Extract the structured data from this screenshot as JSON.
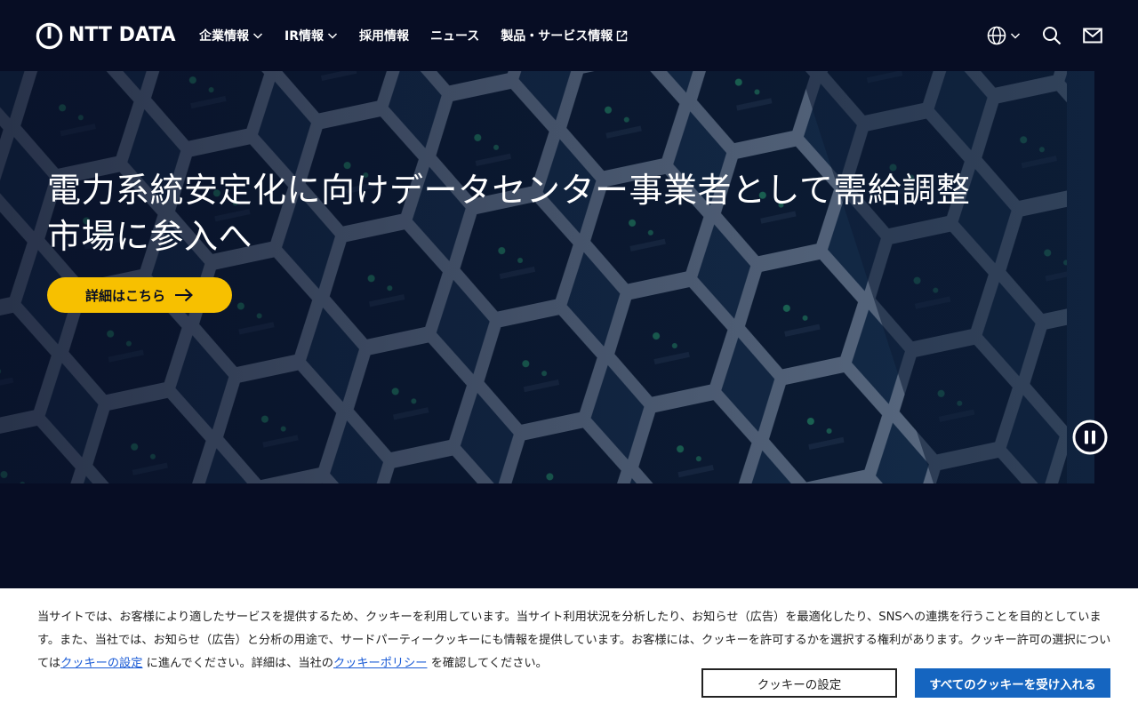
{
  "brand": {
    "logo_text": "NTT DATA",
    "logo_icon": "ntt-data-logo-icon"
  },
  "nav": {
    "items": [
      {
        "label": "企業情報",
        "icon": "chevron-down-icon"
      },
      {
        "label": "IR情報",
        "icon": "chevron-down-icon"
      },
      {
        "label": "採用情報"
      },
      {
        "label": "ニュース"
      },
      {
        "label": "製品・サービス情報",
        "icon": "external-link-icon"
      }
    ]
  },
  "header_actions": {
    "language_icon": "globe-icon",
    "search_icon": "search-icon",
    "contact_icon": "mail-icon"
  },
  "hero": {
    "title": "電力系統安定化に向けデータセンター事業者として需給調整市場に参入へ",
    "cta_label": "詳細はこちら",
    "cta_icon": "arrow-right-icon",
    "pause_icon": "pause-icon",
    "background": "server-rack-photo"
  },
  "cookie": {
    "text_part1": "当サイトでは、お客様により適したサービスを提供するため、クッキーを利用しています。当サイト利用状況を分析したり、お知らせ（広告）を最適化したり、SNSへの連携を行うことを目的としています。また、当社では、お知らせ（広告）と分析の用途で、サードパーティークッキーにも情報を提供しています。お客様には、クッキーを許可するかを選択する権利があります。クッキー許可の選択については",
    "settings_link": "クッキーの設定",
    "text_part2": "に進んでください。詳細は、当社の",
    "policy_link": "クッキーポリシー",
    "text_part3": "を確認してください。",
    "settings_button": "クッキーの設定",
    "accept_button": "すべてのクッキーを受け入れる"
  },
  "colors": {
    "background": "#070d24",
    "cta": "#f7c000",
    "accept_button": "#1565c0",
    "link": "#1a5bd6"
  }
}
